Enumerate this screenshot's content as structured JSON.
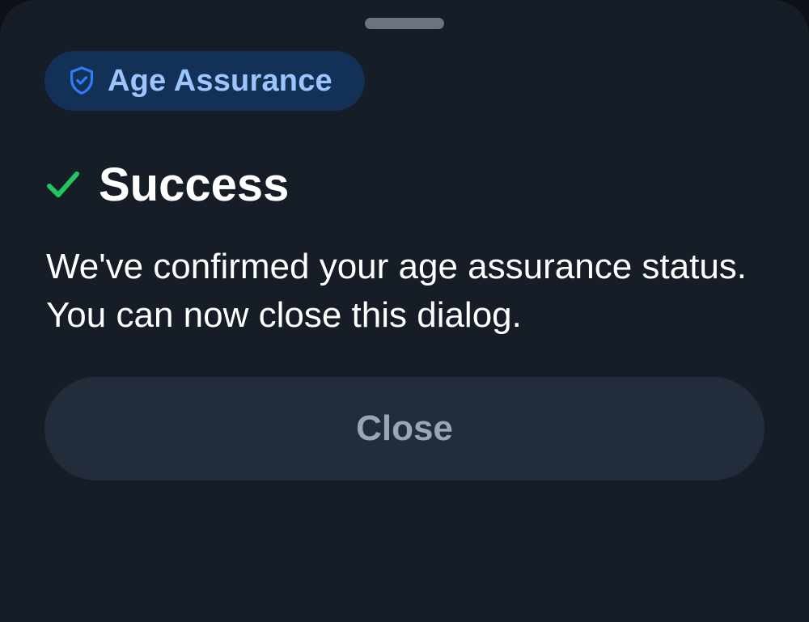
{
  "dialog": {
    "badge": {
      "icon": "shield-check-icon",
      "label": "Age Assurance"
    },
    "status": {
      "icon": "checkmark-icon",
      "title": "Success"
    },
    "message": "We've confirmed your age assurance status. You can now close this dialog.",
    "close_button_label": "Close"
  },
  "colors": {
    "background": "#171d27",
    "badge_background": "#133156",
    "badge_text": "#9cc4ff",
    "shield_icon": "#2f7cf6",
    "success_check": "#22c55e",
    "button_background": "#232c3b",
    "button_text": "#9aa6b8"
  }
}
